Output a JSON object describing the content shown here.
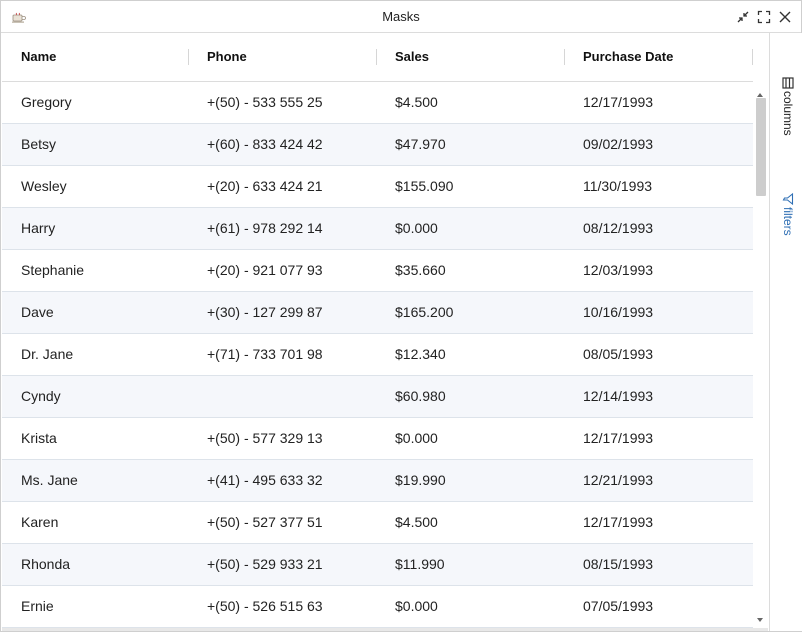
{
  "window": {
    "title": "Masks"
  },
  "icons": {
    "app": "coffee-cup-icon",
    "minimize": "collapse-arrows-icon",
    "maximize": "expand-corners-icon",
    "close": "close-icon",
    "scroll_up": "triangle-up-icon",
    "scroll_down": "triangle-down-icon",
    "columns": "columns-icon",
    "filters": "funnel-icon"
  },
  "colors": {
    "accent": "#2f6fb4",
    "row_alt": "#f5f7fb",
    "border": "#dde3ea"
  },
  "grid": {
    "columns": [
      "Name",
      "Phone",
      "Sales",
      "Purchase Date"
    ],
    "rows": [
      [
        "Gregory",
        "+(50) - 533 555 25",
        "$4.500",
        "12/17/1993"
      ],
      [
        "Betsy",
        "+(60) - 833 424 42",
        "$47.970",
        "09/02/1993"
      ],
      [
        "Wesley",
        "+(20) - 633 424 21",
        "$155.090",
        "11/30/1993"
      ],
      [
        "Harry",
        "+(61) - 978 292 14",
        "$0.000",
        "08/12/1993"
      ],
      [
        "Stephanie",
        "+(20) - 921 077 93",
        "$35.660",
        "12/03/1993"
      ],
      [
        "Dave",
        "+(30) - 127 299 87",
        "$165.200",
        "10/16/1993"
      ],
      [
        "Dr. Jane",
        "+(71) - 733 701 98",
        "$12.340",
        "08/05/1993"
      ],
      [
        "Cyndy",
        "",
        "$60.980",
        "12/14/1993"
      ],
      [
        "Krista",
        "+(50) - 577 329 13",
        "$0.000",
        "12/17/1993"
      ],
      [
        "Ms. Jane",
        "+(41) - 495 633 32",
        "$19.990",
        "12/21/1993"
      ],
      [
        "Karen",
        "+(50) - 527 377 51",
        "$4.500",
        "12/17/1993"
      ],
      [
        "Rhonda",
        "+(50) - 529 933 21",
        "$11.990",
        "08/15/1993"
      ],
      [
        "Ernie",
        "+(50) - 526 515 63",
        "$0.000",
        "07/05/1993"
      ]
    ]
  },
  "sidebar": {
    "columns_label": "columns",
    "filters_label": "filters"
  }
}
